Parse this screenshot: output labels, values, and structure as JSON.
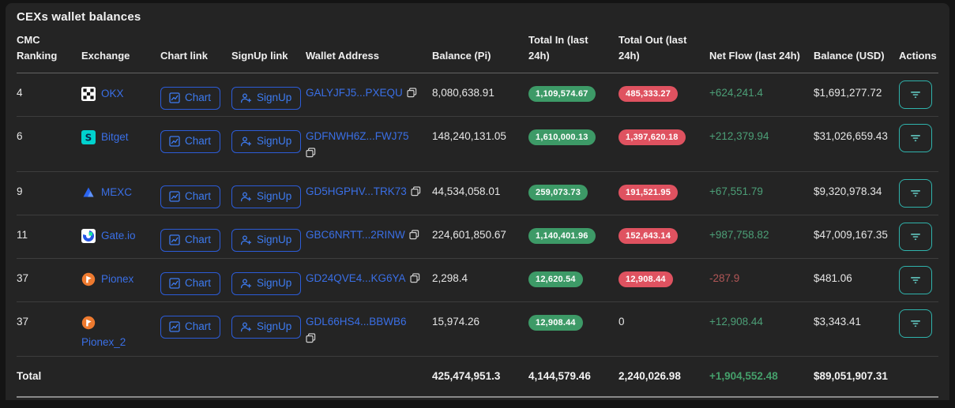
{
  "title": "CEXs wallet balances",
  "labels": {
    "chart": "Chart",
    "signup": "SignUp"
  },
  "colors": {
    "accent_blue": "#3a6fe6",
    "button_border_blue": "#2c5cd8",
    "badge_green": "#3d9a67",
    "badge_red": "#df5260",
    "flow_green": "#4c9f77",
    "flow_red": "#b25757",
    "action_teal": "#2fb3ac",
    "card_bg": "#242424"
  },
  "table": {
    "columns": [
      "CMC Ranking",
      "Exchange",
      "Chart link",
      "SignUp link",
      "Wallet Address",
      "Balance (Pi)",
      "Total In (last 24h)",
      "Total Out (last 24h)",
      "Net Flow (last 24h)",
      "Balance (USD)",
      "Actions"
    ],
    "rows": [
      {
        "rank": "4",
        "exchange": "OKX",
        "address": "GALYJFJ5...PXEQU",
        "balance_pi": "8,080,638.91",
        "total_in": "1,109,574.67",
        "total_out": "485,333.27",
        "net_flow": "+624,241.4",
        "balance_usd": "$1,691,277.72"
      },
      {
        "rank": "6",
        "exchange": "Bitget",
        "address": "GDFNWH6Z...FWJ75",
        "balance_pi": "148,240,131.05",
        "total_in": "1,610,000.13",
        "total_out": "1,397,620.18",
        "net_flow": "+212,379.94",
        "balance_usd": "$31,026,659.43"
      },
      {
        "rank": "9",
        "exchange": "MEXC",
        "address": "GD5HGPHV...TRK73",
        "balance_pi": "44,534,058.01",
        "total_in": "259,073.73",
        "total_out": "191,521.95",
        "net_flow": "+67,551.79",
        "balance_usd": "$9,320,978.34"
      },
      {
        "rank": "11",
        "exchange": "Gate.io",
        "address": "GBC6NRTT...2RINW",
        "balance_pi": "224,601,850.67",
        "total_in": "1,140,401.96",
        "total_out": "152,643.14",
        "net_flow": "+987,758.82",
        "balance_usd": "$47,009,167.35"
      },
      {
        "rank": "37",
        "exchange": "Pionex",
        "address": "GD24QVE4...KG6YA",
        "balance_pi": "2,298.4",
        "total_in": "12,620.54",
        "total_out": "12,908.44",
        "net_flow": "-287.9",
        "balance_usd": "$481.06"
      },
      {
        "rank": "37",
        "exchange": "Pionex_2",
        "address": "GDL66HS4...BBWB6",
        "balance_pi": "15,974.26",
        "total_in": "12,908.44",
        "total_out": "0",
        "net_flow": "+12,908.44",
        "balance_usd": "$3,343.41"
      }
    ],
    "total": {
      "label": "Total",
      "balance_pi": "425,474,951.3",
      "total_in": "4,144,579.46",
      "total_out": "2,240,026.98",
      "net_flow": "+1,904,552.48",
      "balance_usd": "$89,051,907.31"
    }
  }
}
